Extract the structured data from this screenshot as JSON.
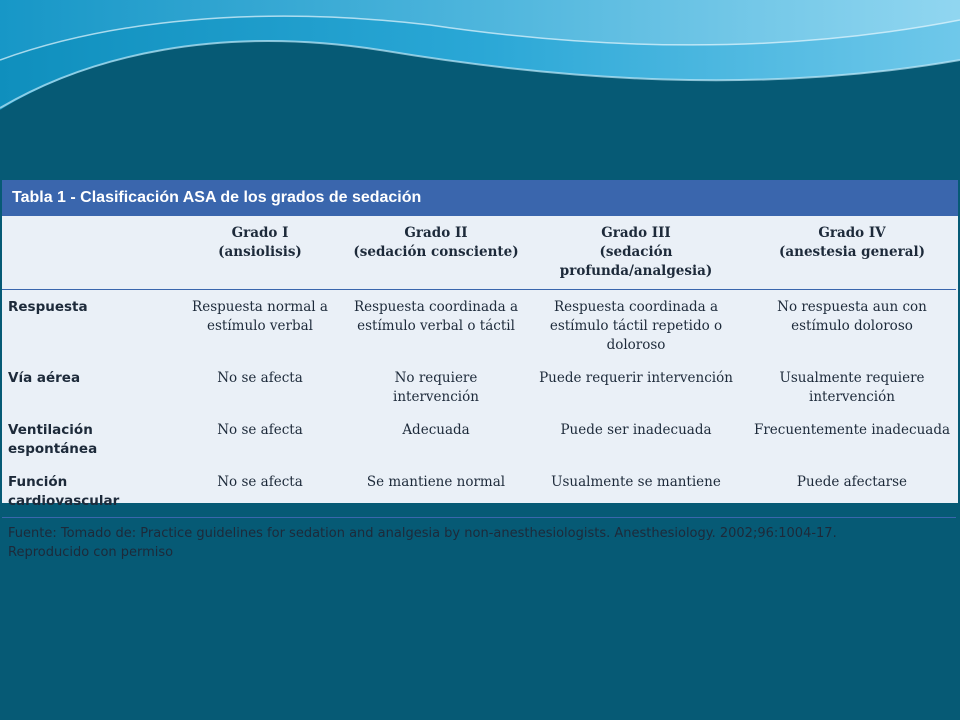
{
  "table": {
    "title": "Tabla 1 - Clasificación ASA de los grados de sedación",
    "columns": [
      {
        "name": "Grado I",
        "sub": "(ansiolisis)"
      },
      {
        "name": "Grado II",
        "sub": "(sedación consciente)"
      },
      {
        "name": "Grado III",
        "sub": "(sedación profunda/analgesia)"
      },
      {
        "name": "Grado IV",
        "sub": "(anestesia general)"
      }
    ],
    "rows": [
      {
        "label": "Respuesta",
        "cells": [
          "Respuesta normal a estímulo verbal",
          "Respuesta coordinada a estímulo verbal o táctil",
          "Respuesta coordinada a estímulo táctil repetido o doloroso",
          "No respuesta aun con estímulo doloroso"
        ]
      },
      {
        "label": "Vía aérea",
        "cells": [
          "No se afecta",
          "No requiere intervención",
          "Puede requerir intervención",
          "Usualmente requiere intervención"
        ]
      },
      {
        "label": "Ventilación espontánea",
        "cells": [
          "No se afecta",
          "Adecuada",
          "Puede ser inadecuada",
          "Frecuentemente inadecuada"
        ]
      },
      {
        "label": "Función cardiovascular",
        "cells": [
          "No se afecta",
          "Se mantiene normal",
          "Usualmente se mantiene",
          "Puede afectarse"
        ]
      }
    ],
    "footnote_line1": "Fuente: Tomado de: Practice guidelines for sedation and analgesia by non-anesthesiologists. Anesthesiology. 2002;96:1004-17.",
    "footnote_line2": "Reproducido con permiso"
  },
  "colors": {
    "background": "#065a75",
    "header_bar": "#3a66ad",
    "table_bg": "#eaf0f7"
  }
}
